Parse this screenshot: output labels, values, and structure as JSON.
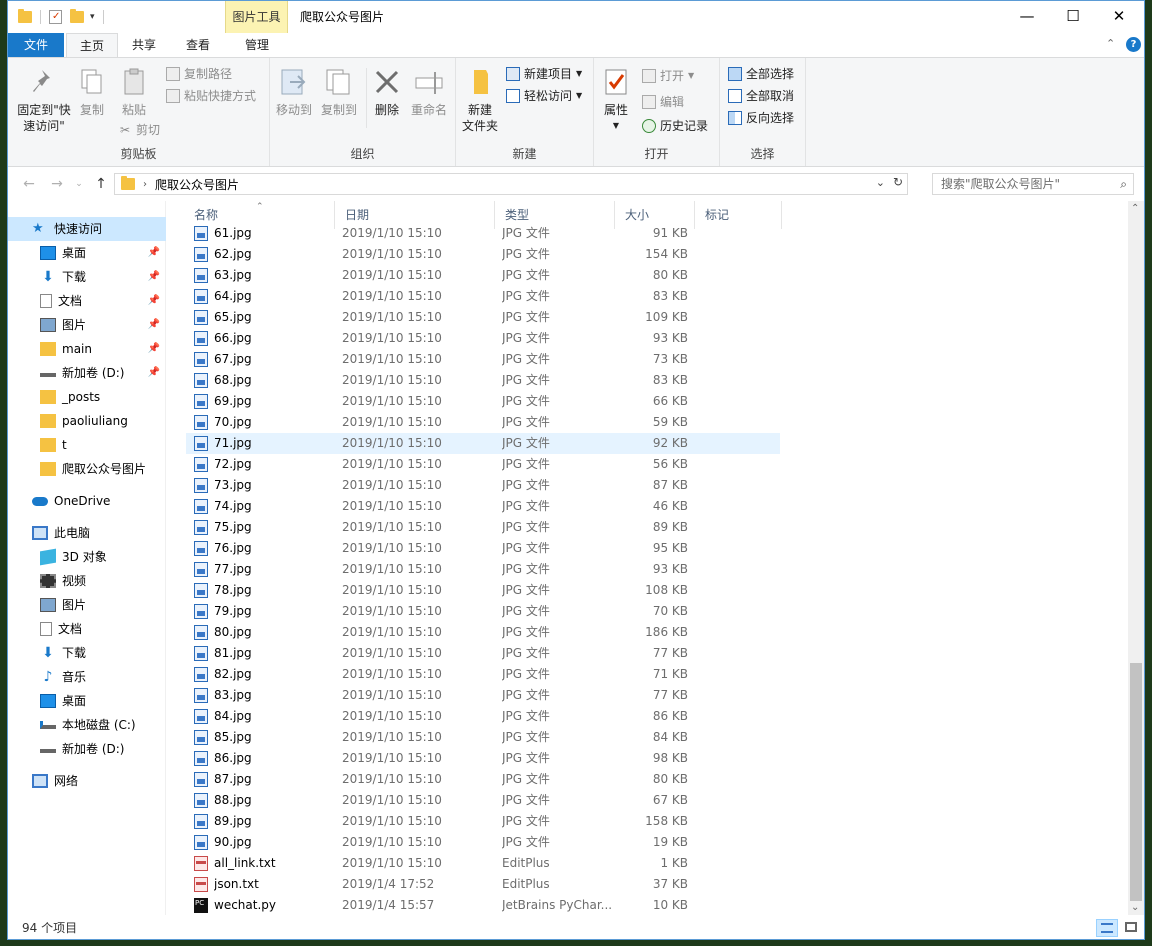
{
  "window": {
    "title": "爬取公众号图片",
    "context_tab": "图片工具",
    "buttons": {
      "minimize": "—",
      "maximize": "☐",
      "close": "✕"
    }
  },
  "tabs": [
    {
      "label": "文件"
    },
    {
      "label": "主页"
    },
    {
      "label": "共享"
    },
    {
      "label": "查看"
    },
    {
      "label": "管理"
    }
  ],
  "ribbon": {
    "clipboard": {
      "label": "剪贴板",
      "pin": "固定到\"快\n速访问\"",
      "pin_line1": "固定到\"快",
      "pin_line2": "速访问\"",
      "copy": "复制",
      "paste": "粘贴",
      "copy_path": "复制路径",
      "paste_shortcut": "粘贴快捷方式",
      "cut": "剪切"
    },
    "organize": {
      "label": "组织",
      "move_to": "移动到",
      "copy_to": "复制到",
      "delete": "删除",
      "rename": "重命名"
    },
    "new": {
      "label": "新建",
      "new_folder_line1": "新建",
      "new_folder_line2": "文件夹",
      "new_item": "新建项目",
      "easy_access": "轻松访问"
    },
    "open": {
      "label": "打开",
      "properties": "属性",
      "open": "打开",
      "edit": "编辑",
      "history": "历史记录"
    },
    "select": {
      "label": "选择",
      "select_all": "全部选择",
      "select_none": "全部取消",
      "invert": "反向选择"
    }
  },
  "address": {
    "path": "爬取公众号图片",
    "search_placeholder": "搜索\"爬取公众号图片\""
  },
  "nav": {
    "quick_access": "快速访问",
    "items": [
      {
        "label": "桌面",
        "pinned": true
      },
      {
        "label": "下载",
        "pinned": true
      },
      {
        "label": "文档",
        "pinned": true
      },
      {
        "label": "图片",
        "pinned": true
      },
      {
        "label": "main",
        "pinned": true
      },
      {
        "label": "新加卷 (D:)",
        "pinned": true
      },
      {
        "label": "_posts",
        "pinned": false
      },
      {
        "label": "paoliuliang",
        "pinned": false
      },
      {
        "label": "t",
        "pinned": false
      },
      {
        "label": "爬取公众号图片",
        "pinned": false
      }
    ],
    "onedrive": "OneDrive",
    "this_pc": "此电脑",
    "pc_items": [
      {
        "label": "3D 对象"
      },
      {
        "label": "视频"
      },
      {
        "label": "图片"
      },
      {
        "label": "文档"
      },
      {
        "label": "下载"
      },
      {
        "label": "音乐"
      },
      {
        "label": "桌面"
      },
      {
        "label": "本地磁盘 (C:)"
      },
      {
        "label": "新加卷 (D:)"
      }
    ],
    "network": "网络"
  },
  "columns": {
    "name": "名称",
    "date": "日期",
    "type": "类型",
    "size": "大小",
    "tags": "标记"
  },
  "files": [
    {
      "name": "61.jpg",
      "date": "2019/1/10 15:10",
      "type": "JPG 文件",
      "size": "91 KB"
    },
    {
      "name": "62.jpg",
      "date": "2019/1/10 15:10",
      "type": "JPG 文件",
      "size": "154 KB"
    },
    {
      "name": "63.jpg",
      "date": "2019/1/10 15:10",
      "type": "JPG 文件",
      "size": "80 KB"
    },
    {
      "name": "64.jpg",
      "date": "2019/1/10 15:10",
      "type": "JPG 文件",
      "size": "83 KB"
    },
    {
      "name": "65.jpg",
      "date": "2019/1/10 15:10",
      "type": "JPG 文件",
      "size": "109 KB"
    },
    {
      "name": "66.jpg",
      "date": "2019/1/10 15:10",
      "type": "JPG 文件",
      "size": "93 KB"
    },
    {
      "name": "67.jpg",
      "date": "2019/1/10 15:10",
      "type": "JPG 文件",
      "size": "73 KB"
    },
    {
      "name": "68.jpg",
      "date": "2019/1/10 15:10",
      "type": "JPG 文件",
      "size": "83 KB"
    },
    {
      "name": "69.jpg",
      "date": "2019/1/10 15:10",
      "type": "JPG 文件",
      "size": "66 KB"
    },
    {
      "name": "70.jpg",
      "date": "2019/1/10 15:10",
      "type": "JPG 文件",
      "size": "59 KB"
    },
    {
      "name": "71.jpg",
      "date": "2019/1/10 15:10",
      "type": "JPG 文件",
      "size": "92 KB"
    },
    {
      "name": "72.jpg",
      "date": "2019/1/10 15:10",
      "type": "JPG 文件",
      "size": "56 KB"
    },
    {
      "name": "73.jpg",
      "date": "2019/1/10 15:10",
      "type": "JPG 文件",
      "size": "87 KB"
    },
    {
      "name": "74.jpg",
      "date": "2019/1/10 15:10",
      "type": "JPG 文件",
      "size": "46 KB"
    },
    {
      "name": "75.jpg",
      "date": "2019/1/10 15:10",
      "type": "JPG 文件",
      "size": "89 KB"
    },
    {
      "name": "76.jpg",
      "date": "2019/1/10 15:10",
      "type": "JPG 文件",
      "size": "95 KB"
    },
    {
      "name": "77.jpg",
      "date": "2019/1/10 15:10",
      "type": "JPG 文件",
      "size": "93 KB"
    },
    {
      "name": "78.jpg",
      "date": "2019/1/10 15:10",
      "type": "JPG 文件",
      "size": "108 KB"
    },
    {
      "name": "79.jpg",
      "date": "2019/1/10 15:10",
      "type": "JPG 文件",
      "size": "70 KB"
    },
    {
      "name": "80.jpg",
      "date": "2019/1/10 15:10",
      "type": "JPG 文件",
      "size": "186 KB"
    },
    {
      "name": "81.jpg",
      "date": "2019/1/10 15:10",
      "type": "JPG 文件",
      "size": "77 KB"
    },
    {
      "name": "82.jpg",
      "date": "2019/1/10 15:10",
      "type": "JPG 文件",
      "size": "71 KB"
    },
    {
      "name": "83.jpg",
      "date": "2019/1/10 15:10",
      "type": "JPG 文件",
      "size": "77 KB"
    },
    {
      "name": "84.jpg",
      "date": "2019/1/10 15:10",
      "type": "JPG 文件",
      "size": "86 KB"
    },
    {
      "name": "85.jpg",
      "date": "2019/1/10 15:10",
      "type": "JPG 文件",
      "size": "84 KB"
    },
    {
      "name": "86.jpg",
      "date": "2019/1/10 15:10",
      "type": "JPG 文件",
      "size": "98 KB"
    },
    {
      "name": "87.jpg",
      "date": "2019/1/10 15:10",
      "type": "JPG 文件",
      "size": "80 KB"
    },
    {
      "name": "88.jpg",
      "date": "2019/1/10 15:10",
      "type": "JPG 文件",
      "size": "67 KB"
    },
    {
      "name": "89.jpg",
      "date": "2019/1/10 15:10",
      "type": "JPG 文件",
      "size": "158 KB"
    },
    {
      "name": "90.jpg",
      "date": "2019/1/10 15:10",
      "type": "JPG 文件",
      "size": "19 KB"
    },
    {
      "name": "all_link.txt",
      "date": "2019/1/10 15:10",
      "type": "EditPlus",
      "size": "1 KB"
    },
    {
      "name": "json.txt",
      "date": "2019/1/4 17:52",
      "type": "EditPlus",
      "size": "37 KB"
    },
    {
      "name": "wechat.py",
      "date": "2019/1/4 15:57",
      "type": "JetBrains PyChar...",
      "size": "10 KB"
    }
  ],
  "selected_file": "71.jpg",
  "status": {
    "count": "94 个项目"
  },
  "colors": {
    "accent": "#1979ca",
    "selection": "#e5f3ff",
    "context_tab": "#fcf3b3"
  }
}
